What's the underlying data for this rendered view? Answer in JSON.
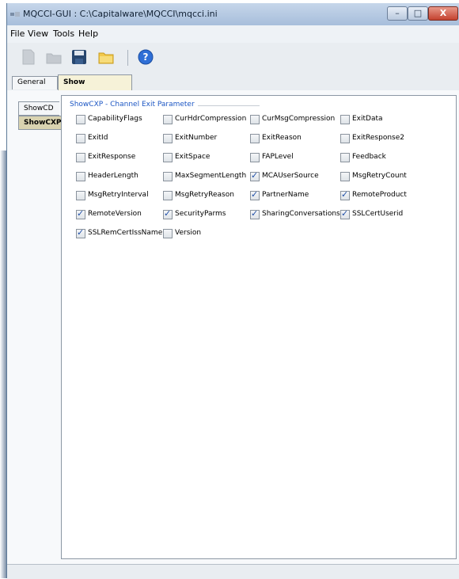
{
  "window": {
    "title": "MQCCI-GUI : C:\\Capitalware\\MQCCI\\mqcci.ini",
    "minimize_glyph": "–",
    "maximize_glyph": "□",
    "close_glyph": "X"
  },
  "menu": {
    "items": [
      "File",
      "View",
      "Tools",
      "Help"
    ]
  },
  "toolbar": {
    "icons": [
      "new-icon",
      "open-disabled-icon",
      "save-icon",
      "folder-icon",
      "help-icon"
    ]
  },
  "tabs": {
    "general": "General",
    "show_structures": "Show Structures"
  },
  "side_tabs": {
    "showcd": "ShowCD",
    "showcxp": "ShowCXP"
  },
  "group": {
    "title": "ShowCXP - Channel Exit Parameter"
  },
  "checkboxes": [
    {
      "label": "CapabilityFlags",
      "checked": false
    },
    {
      "label": "CurHdrCompression",
      "checked": false
    },
    {
      "label": "CurMsgCompression",
      "checked": false
    },
    {
      "label": "ExitData",
      "checked": false
    },
    {
      "label": "ExitId",
      "checked": false
    },
    {
      "label": "ExitNumber",
      "checked": false
    },
    {
      "label": "ExitReason",
      "checked": false
    },
    {
      "label": "ExitResponse2",
      "checked": false
    },
    {
      "label": "ExitResponse",
      "checked": false
    },
    {
      "label": "ExitSpace",
      "checked": false
    },
    {
      "label": "FAPLevel",
      "checked": false
    },
    {
      "label": "Feedback",
      "checked": false
    },
    {
      "label": "HeaderLength",
      "checked": false
    },
    {
      "label": "MaxSegmentLength",
      "checked": false
    },
    {
      "label": "MCAUserSource",
      "checked": true
    },
    {
      "label": "MsgRetryCount",
      "checked": false
    },
    {
      "label": "MsgRetryInterval",
      "checked": false
    },
    {
      "label": "MsgRetryReason",
      "checked": false
    },
    {
      "label": "PartnerName",
      "checked": true
    },
    {
      "label": "RemoteProduct",
      "checked": true
    },
    {
      "label": "RemoteVersion",
      "checked": true
    },
    {
      "label": "SecurityParms",
      "checked": true
    },
    {
      "label": "SharingConversations",
      "checked": true
    },
    {
      "label": "SSLCertUserid",
      "checked": true
    },
    {
      "label": "SSLRemCertIssName",
      "checked": true
    },
    {
      "label": "Version",
      "checked": false
    }
  ],
  "colors": {
    "group_title": "#1d57c4",
    "active_tab": "#f6f2d8",
    "titlebar": "#a7bedb"
  }
}
